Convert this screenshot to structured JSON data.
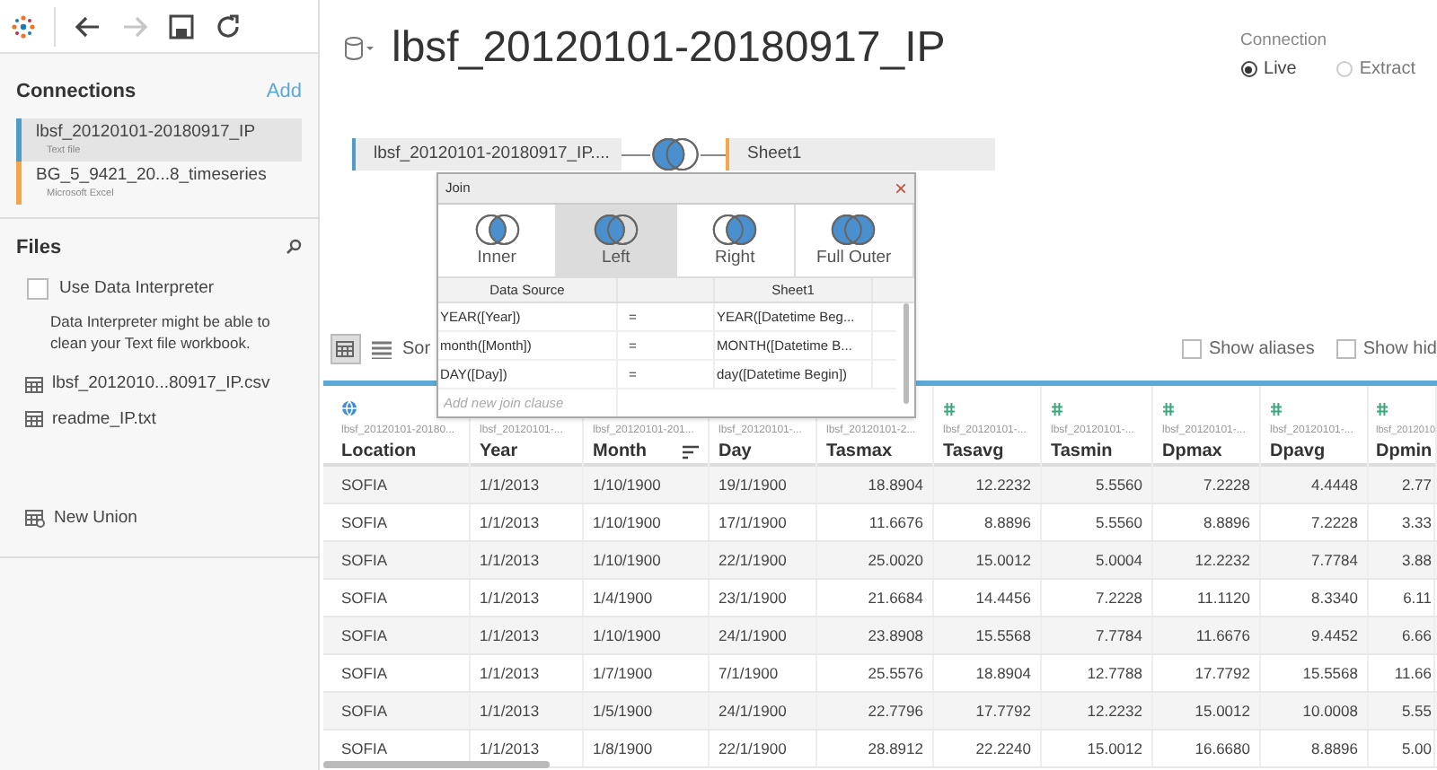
{
  "toolbar": {
    "buttons": [
      {
        "kind": "back",
        "disabled": false
      },
      {
        "kind": "forward",
        "disabled": true
      },
      {
        "kind": "save",
        "disabled": false
      },
      {
        "kind": "refresh",
        "disabled": false
      }
    ]
  },
  "sidebar": {
    "connections_title": "Connections",
    "add_link": "Add",
    "connections": [
      {
        "name": "lbsf_20120101-20180917_IP",
        "type": "Text file",
        "color": "#4e9dc9",
        "selected": true
      },
      {
        "name": "BG_5_9421_20...8_timeseries",
        "type": "Microsoft Excel",
        "color": "#f5a54a",
        "selected": false
      }
    ],
    "files_title": "Files",
    "data_interpreter": {
      "label": "Use Data Interpreter",
      "checked": false,
      "hint": "Data Interpreter might be able to clean your Text file workbook."
    },
    "files": [
      "lbsf_2012010...80917_IP.csv",
      "readme_IP.txt"
    ],
    "new_union": "New Union"
  },
  "title": "lbsf_20120101-20180917_IP",
  "connection": {
    "label": "Connection",
    "options": [
      {
        "label": "Live",
        "selected": true
      },
      {
        "label": "Extract",
        "selected": false
      }
    ]
  },
  "canvas": {
    "left_table": "lbsf_20120101-20180917_IP....",
    "right_table": "Sheet1",
    "join": {
      "kind": "left"
    }
  },
  "join_dialog": {
    "title": "Join",
    "close": "×",
    "types": [
      {
        "kind": "inner",
        "label": "Inner",
        "selected": false
      },
      {
        "kind": "left",
        "label": "Left",
        "selected": true
      },
      {
        "kind": "right",
        "label": "Right",
        "selected": false
      },
      {
        "kind": "full",
        "label": "Full Outer",
        "selected": false
      }
    ],
    "columns": [
      "Data Source",
      "",
      "Sheet1"
    ],
    "clauses": [
      [
        "YEAR([Year])",
        "=",
        "YEAR([Datetime Beg..."
      ],
      [
        "month([Month])",
        "=",
        "MONTH([Datetime B..."
      ],
      [
        "DAY([Day])",
        "=",
        "day([Datetime Begin])"
      ]
    ],
    "add_clause_placeholder": "Add new join clause"
  },
  "grid_toolbar": {
    "sort_label": "Sor",
    "checkboxes": [
      {
        "label": "Show aliases",
        "checked": false
      },
      {
        "label": "Show hid",
        "checked": false
      }
    ]
  },
  "table": {
    "columns": [
      {
        "name": "Location",
        "source": "lbsf_20120101-20180...",
        "kind": "geo",
        "sorted": false
      },
      {
        "name": "Year",
        "source": "lbsf_20120101-...",
        "sorted": false
      },
      {
        "name": "Month",
        "source": "lbsf_20120101-201...",
        "sorted": true
      },
      {
        "name": "Day",
        "source": "lbsf_20120101-...",
        "sorted": false
      },
      {
        "name": "Tasmax",
        "source": "lbsf_20120101-2...",
        "sorted": false
      },
      {
        "name": "Tasavg",
        "source": "lbsf_20120101-...",
        "kind": "number",
        "sorted": false
      },
      {
        "name": "Tasmin",
        "source": "lbsf_20120101-...",
        "kind": "number",
        "sorted": false
      },
      {
        "name": "Dpmax",
        "source": "lbsf_20120101-...",
        "kind": "number",
        "sorted": false
      },
      {
        "name": "Dpavg",
        "source": "lbsf_20120101-...",
        "kind": "number",
        "sorted": false
      },
      {
        "name": "Dpmin",
        "source": "lbsf_2012010",
        "kind": "number",
        "sorted": false
      }
    ],
    "rows": [
      [
        "SOFIA",
        "1/1/2013",
        "1/10/1900",
        "19/1/1900",
        "18.8904",
        "12.2232",
        "5.5560",
        "7.2228",
        "4.4448",
        "2.77"
      ],
      [
        "SOFIA",
        "1/1/2013",
        "1/10/1900",
        "17/1/1900",
        "11.6676",
        "8.8896",
        "5.5560",
        "8.8896",
        "7.2228",
        "3.33"
      ],
      [
        "SOFIA",
        "1/1/2013",
        "1/10/1900",
        "22/1/1900",
        "25.0020",
        "15.0012",
        "5.0004",
        "12.2232",
        "7.7784",
        "3.88"
      ],
      [
        "SOFIA",
        "1/1/2013",
        "1/4/1900",
        "23/1/1900",
        "21.6684",
        "14.4456",
        "7.2228",
        "11.1120",
        "8.3340",
        "6.11"
      ],
      [
        "SOFIA",
        "1/1/2013",
        "1/10/1900",
        "24/1/1900",
        "23.8908",
        "15.5568",
        "7.7784",
        "11.6676",
        "9.4452",
        "6.66"
      ],
      [
        "SOFIA",
        "1/1/2013",
        "1/7/1900",
        "7/1/1900",
        "25.5576",
        "18.8904",
        "12.7788",
        "17.7792",
        "15.5568",
        "11.66"
      ],
      [
        "SOFIA",
        "1/1/2013",
        "1/5/1900",
        "24/1/1900",
        "22.7796",
        "17.7792",
        "12.2232",
        "15.0012",
        "10.0008",
        "5.55"
      ],
      [
        "SOFIA",
        "1/1/2013",
        "1/8/1900",
        "22/1/1900",
        "28.8912",
        "22.2240",
        "15.0012",
        "16.6680",
        "8.8896",
        "5.00"
      ]
    ]
  }
}
